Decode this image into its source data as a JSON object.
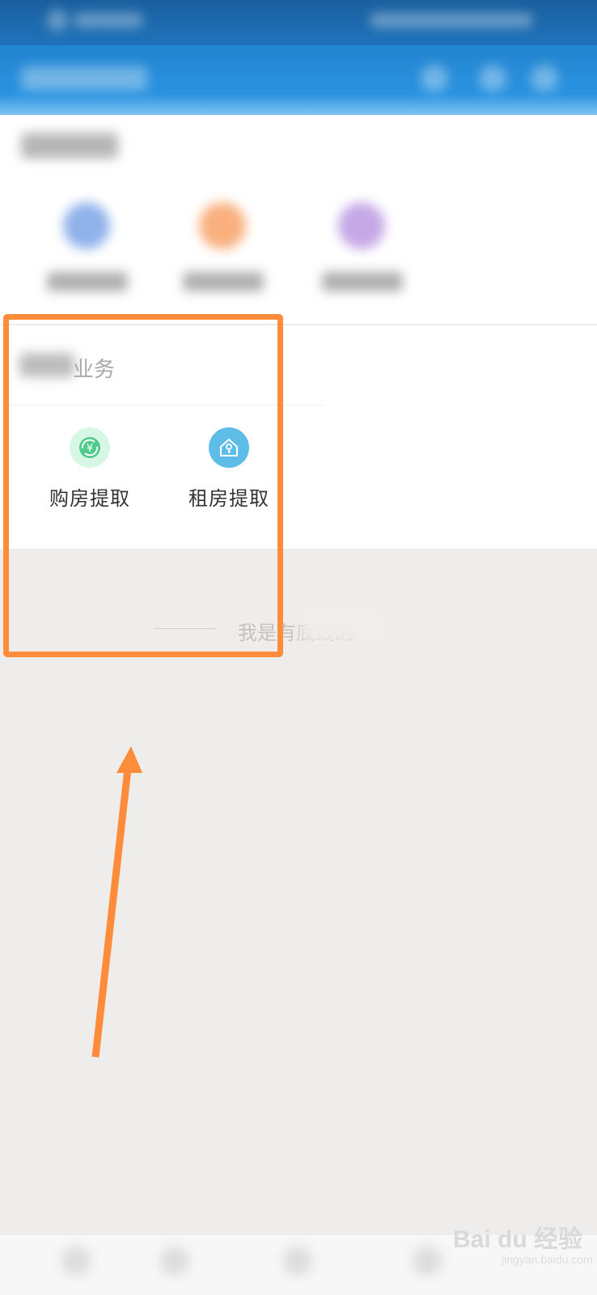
{
  "section": {
    "title_visible_suffix": "业务",
    "items": [
      {
        "label": "购房提取",
        "icon": "yuan-exchange-icon",
        "color": "#4ccb8a",
        "bg": "#d8f6e6"
      },
      {
        "label": "租房提取",
        "icon": "house-key-icon",
        "color": "#ffffff",
        "bg": "#5dbde6"
      }
    ]
  },
  "footer": {
    "text": "我是有底线的"
  },
  "watermark": {
    "logo": "Bai du 经验",
    "url": "jingyan.baidu.com"
  },
  "colors": {
    "annotation": "#ff8c3b",
    "header": "#2a93e0",
    "background": "#efedec"
  }
}
